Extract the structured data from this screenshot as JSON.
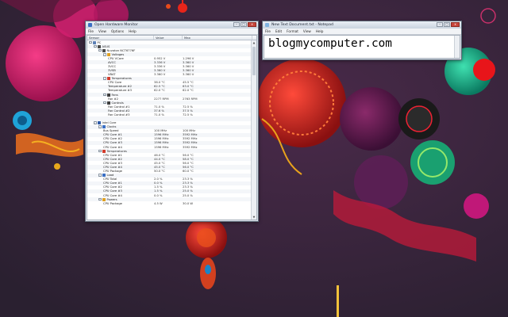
{
  "hardware_monitor": {
    "title": "Open Hardware Monitor",
    "menu": [
      "File",
      "View",
      "Options",
      "Help"
    ],
    "columns": [
      "Sensor",
      "Value",
      "Max"
    ],
    "controls": {
      "minimize": "–",
      "maximize": "□",
      "close": "x"
    },
    "rows": [
      {
        "indent": 0,
        "exp": "-",
        "icon": "computer-icon",
        "name": "PC",
        "value": "",
        "max": ""
      },
      {
        "indent": 1,
        "exp": "-",
        "icon": "motherboard-icon",
        "name": "ASUS",
        "value": "",
        "max": ""
      },
      {
        "indent": 2,
        "exp": "-",
        "icon": "chip-icon",
        "name": "Nuvoton NCT6776F",
        "value": "",
        "max": ""
      },
      {
        "indent": 3,
        "exp": "-",
        "icon": "voltage-icon",
        "name": "Voltages",
        "value": "",
        "max": ""
      },
      {
        "indent": 4,
        "exp": "",
        "icon": "",
        "name": "CPU VCore",
        "value": "0.952 V",
        "max": "1.296 V"
      },
      {
        "indent": 4,
        "exp": "",
        "icon": "",
        "name": "AVCC",
        "value": "3.336 V",
        "max": "3.360 V"
      },
      {
        "indent": 4,
        "exp": "",
        "icon": "",
        "name": "3VCC",
        "value": "3.336 V",
        "max": "3.360 V"
      },
      {
        "indent": 4,
        "exp": "",
        "icon": "",
        "name": "3VSB",
        "value": "3.360 V",
        "max": "3.360 V"
      },
      {
        "indent": 4,
        "exp": "",
        "icon": "",
        "name": "VBAT",
        "value": "3.360 V",
        "max": "3.360 V"
      },
      {
        "indent": 3,
        "exp": "-",
        "icon": "thermometer-icon",
        "name": "Temperatures",
        "value": "",
        "max": ""
      },
      {
        "indent": 4,
        "exp": "",
        "icon": "",
        "name": "CPU Core",
        "value": "38.0 °C",
        "max": "45.5 °C"
      },
      {
        "indent": 4,
        "exp": "",
        "icon": "",
        "name": "Temperature #2",
        "value": "62.5 °C",
        "max": "63.0 °C"
      },
      {
        "indent": 4,
        "exp": "",
        "icon": "",
        "name": "Temperature #3",
        "value": "62.0 °C",
        "max": "62.0 °C"
      },
      {
        "indent": 3,
        "exp": "-",
        "icon": "fan-icon",
        "name": "Fans",
        "value": "",
        "max": ""
      },
      {
        "indent": 4,
        "exp": "",
        "icon": "",
        "name": "Fan #2",
        "value": "2277 RPM",
        "max": "2763 RPM"
      },
      {
        "indent": 3,
        "exp": "-",
        "icon": "control-icon",
        "name": "Controls",
        "value": "",
        "max": ""
      },
      {
        "indent": 4,
        "exp": "",
        "icon": "",
        "name": "Fan Control #1",
        "value": "71.0 %",
        "max": "72.5 %"
      },
      {
        "indent": 4,
        "exp": "",
        "icon": "",
        "name": "Fan Control #2",
        "value": "37.6 %",
        "max": "37.5 %"
      },
      {
        "indent": 4,
        "exp": "",
        "icon": "",
        "name": "Fan Control #3",
        "value": "71.0 %",
        "max": "72.5 %"
      },
      {
        "indent": 0,
        "exp": "",
        "icon": "",
        "name": "",
        "value": "",
        "max": ""
      },
      {
        "indent": 1,
        "exp": "-",
        "icon": "cpu-icon",
        "name": "Intel Core",
        "value": "",
        "max": ""
      },
      {
        "indent": 2,
        "exp": "-",
        "icon": "clock-icon",
        "name": "Clocks",
        "value": "",
        "max": ""
      },
      {
        "indent": 3,
        "exp": "",
        "icon": "",
        "name": "Bus Speed",
        "value": "100 MHz",
        "max": "100 MHz"
      },
      {
        "indent": 3,
        "exp": "",
        "icon": "",
        "name": "CPU Core #1",
        "value": "1596 MHz",
        "max": "3592 MHz"
      },
      {
        "indent": 3,
        "exp": "",
        "icon": "",
        "name": "CPU Core #2",
        "value": "1596 MHz",
        "max": "3592 MHz"
      },
      {
        "indent": 3,
        "exp": "",
        "icon": "",
        "name": "CPU Core #3",
        "value": "1596 MHz",
        "max": "3592 MHz"
      },
      {
        "indent": 3,
        "exp": "",
        "icon": "",
        "name": "CPU Core #4",
        "value": "1596 MHz",
        "max": "3592 MHz"
      },
      {
        "indent": 2,
        "exp": "-",
        "icon": "thermometer-icon",
        "name": "Temperatures",
        "value": "",
        "max": ""
      },
      {
        "indent": 3,
        "exp": "",
        "icon": "",
        "name": "CPU Core #1",
        "value": "46.0 °C",
        "max": "56.0 °C"
      },
      {
        "indent": 3,
        "exp": "",
        "icon": "",
        "name": "CPU Core #2",
        "value": "44.0 °C",
        "max": "58.0 °C"
      },
      {
        "indent": 3,
        "exp": "",
        "icon": "",
        "name": "CPU Core #3",
        "value": "45.0 °C",
        "max": "56.0 °C"
      },
      {
        "indent": 3,
        "exp": "",
        "icon": "",
        "name": "CPU Core #4",
        "value": "45.0 °C",
        "max": "56.0 °C"
      },
      {
        "indent": 3,
        "exp": "",
        "icon": "",
        "name": "CPU Package",
        "value": "50.0 °C",
        "max": "60.0 °C"
      },
      {
        "indent": 2,
        "exp": "-",
        "icon": "load-icon",
        "name": "Load",
        "value": "",
        "max": ""
      },
      {
        "indent": 3,
        "exp": "",
        "icon": "",
        "name": "CPU Total",
        "value": "2.0 %",
        "max": "23.3 %"
      },
      {
        "indent": 3,
        "exp": "",
        "icon": "",
        "name": "CPU Core #1",
        "value": "0.0 %",
        "max": "23.3 %"
      },
      {
        "indent": 3,
        "exp": "",
        "icon": "",
        "name": "CPU Core #2",
        "value": "1.5 %",
        "max": "23.3 %"
      },
      {
        "indent": 3,
        "exp": "",
        "icon": "",
        "name": "CPU Core #3",
        "value": "1.5 %",
        "max": "25.0 %"
      },
      {
        "indent": 3,
        "exp": "",
        "icon": "",
        "name": "CPU Core #4",
        "value": "0.0 %",
        "max": "25.0 %"
      },
      {
        "indent": 2,
        "exp": "-",
        "icon": "power-icon",
        "name": "Powers",
        "value": "",
        "max": ""
      },
      {
        "indent": 3,
        "exp": "",
        "icon": "",
        "name": "CPU Package",
        "value": "4.5 W",
        "max": "30.0 W"
      }
    ]
  },
  "notepad": {
    "title": "New Text Document.txt - Notepad",
    "menu": [
      "File",
      "Edit",
      "Format",
      "View",
      "Help"
    ],
    "controls": {
      "minimize": "–",
      "maximize": "□",
      "close": "x"
    },
    "content": "blogmycomputer.com"
  },
  "colors": {
    "icon_computer": "#5b7fb5",
    "icon_board": "#4a4a4a",
    "icon_voltage": "#e0a020",
    "icon_temp": "#d23b2b",
    "icon_fan": "#3d3d3d",
    "icon_cpu": "#2d5aa8",
    "icon_load": "#3a6fc4"
  }
}
